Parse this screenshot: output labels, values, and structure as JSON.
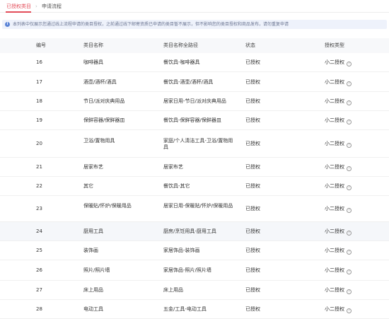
{
  "tabs": [
    {
      "label": "已授权类目"
    },
    {
      "label": "申请流程"
    }
  ],
  "tab_separator": "›",
  "notice": {
    "icon": "info-icon",
    "icon_glyph": "i",
    "text": "本列表中仅展示您通过线上流程申请的类目授权，之前通过线下邮寄资质已申请的类目暂不展示，但不影响您的类目授权和商品发布，请勿重复申请"
  },
  "table": {
    "headers": {
      "no": "编号",
      "name": "类目名称",
      "path": "类目名称全路径",
      "status": "状态",
      "type": "授权类型"
    },
    "help_glyph": "?",
    "rows": [
      {
        "no": "16",
        "name": "咖啡器具",
        "path": "餐饮具-咖啡器具",
        "status": "已授权",
        "type": "小二授权"
      },
      {
        "no": "17",
        "name": "酒壶/酒杯/酒具",
        "path": "餐饮具-酒壶/酒杯/酒具",
        "status": "已授权",
        "type": "小二授权"
      },
      {
        "no": "18",
        "name": "节日/派对庆典用品",
        "path": "居家日用-节日/派对庆典用品",
        "status": "已授权",
        "type": "小二授权"
      },
      {
        "no": "19",
        "name": "保鲜容器/保鲜器皿",
        "path": "餐饮具-保鲜容器/保鲜器皿",
        "status": "已授权",
        "type": "小二授权"
      },
      {
        "no": "20",
        "name": "卫浴/置物用具",
        "path": "家庭/个人清洁工具-卫浴/置物用具",
        "status": "已授权",
        "type": "小二授权"
      },
      {
        "no": "21",
        "name": "居家布艺",
        "path": "居家布艺",
        "status": "已授权",
        "type": "小二授权"
      },
      {
        "no": "22",
        "name": "其它",
        "path": "餐饮具-其它",
        "status": "已授权",
        "type": "小二授权"
      },
      {
        "no": "23",
        "name": "保暖贴/怀炉/保暖用品",
        "path": "居家日用-保暖贴/怀炉/保暖用品",
        "status": "已授权",
        "type": "小二授权"
      },
      {
        "no": "24",
        "name": "厨用工具",
        "path": "厨房/烹饪用具-厨用工具",
        "status": "已授权",
        "type": "小二授权"
      },
      {
        "no": "25",
        "name": "装饰画",
        "path": "家居饰品-装饰画",
        "status": "已授权",
        "type": "小二授权"
      },
      {
        "no": "26",
        "name": "照片/照片墙",
        "path": "家居饰品-照片/照片墙",
        "status": "已授权",
        "type": "小二授权"
      },
      {
        "no": "27",
        "name": "床上用品",
        "path": "床上用品",
        "status": "已授权",
        "type": "小二授权"
      },
      {
        "no": "28",
        "name": "电动工具",
        "path": "五金/工具-电动工具",
        "status": "已授权",
        "type": "小二授权"
      }
    ]
  }
}
